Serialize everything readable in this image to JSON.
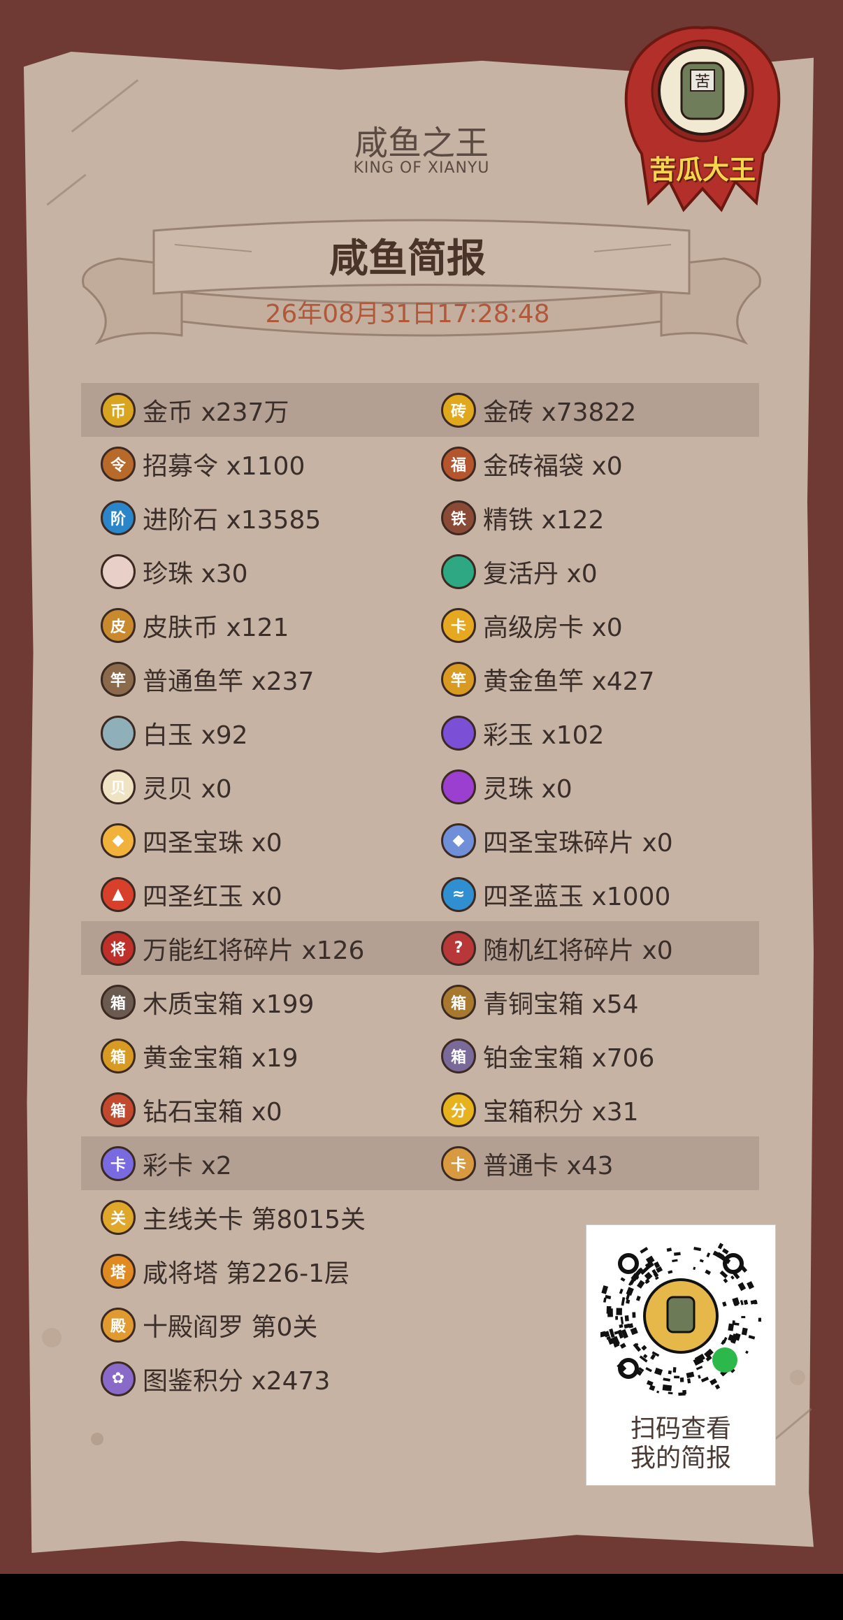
{
  "header": {
    "title": "咸鱼之王",
    "subtitle": "KING OF XIANYU",
    "banner_title": "咸鱼简报",
    "date": "26年08月31日17:28:48"
  },
  "player": {
    "name": "苦瓜大王",
    "avatar_glyph": "苦"
  },
  "colors": {
    "frame": "#6e3a33",
    "paper": "#c7b3a3",
    "highlight_row": "#b3a092",
    "date_text": "#b0593a",
    "seal_red": "#c0392b",
    "seal_text": "#f6d64a"
  },
  "items": [
    {
      "highlight": true,
      "left": {
        "label": "金币 x237万",
        "icon": "coin-icon",
        "color": "#d9a520",
        "glyph": "币"
      },
      "right": {
        "label": "金砖 x73822",
        "icon": "gold-brick-icon",
        "color": "#e0a81c",
        "glyph": "砖"
      }
    },
    {
      "highlight": false,
      "left": {
        "label": "招募令 x1100",
        "icon": "recruit-order-icon",
        "color": "#b86a2a",
        "glyph": "令"
      },
      "right": {
        "label": "金砖福袋 x0",
        "icon": "lucky-bag-icon",
        "color": "#b5552e",
        "glyph": "福"
      }
    },
    {
      "highlight": false,
      "left": {
        "label": "进阶石 x13585",
        "icon": "upgrade-stone-icon",
        "color": "#2a86c8",
        "glyph": "阶"
      },
      "right": {
        "label": "精铁 x122",
        "icon": "iron-icon",
        "color": "#8a4a36",
        "glyph": "铁"
      }
    },
    {
      "highlight": false,
      "left": {
        "label": "珍珠 x30",
        "icon": "pearl-icon",
        "color": "#e8cfc8",
        "glyph": ""
      },
      "right": {
        "label": "复活丹 x0",
        "icon": "revive-pill-icon",
        "color": "#2ea882",
        "glyph": ""
      }
    },
    {
      "highlight": false,
      "left": {
        "label": "皮肤币 x121",
        "icon": "skin-coin-icon",
        "color": "#c98a2e",
        "glyph": "皮"
      },
      "right": {
        "label": "高级房卡 x0",
        "icon": "room-card-icon",
        "color": "#e6a820",
        "glyph": "卡"
      }
    },
    {
      "highlight": false,
      "left": {
        "label": "普通鱼竿 x237",
        "icon": "fishing-rod-icon",
        "color": "#8a6a4a",
        "glyph": "竿"
      },
      "right": {
        "label": "黄金鱼竿 x427",
        "icon": "golden-rod-icon",
        "color": "#d99a22",
        "glyph": "竿"
      }
    },
    {
      "highlight": false,
      "left": {
        "label": "白玉 x92",
        "icon": "white-jade-icon",
        "color": "#8fb0b8",
        "glyph": ""
      },
      "right": {
        "label": "彩玉 x102",
        "icon": "color-jade-icon",
        "color": "#7b4fd6",
        "glyph": ""
      }
    },
    {
      "highlight": false,
      "left": {
        "label": "灵贝 x0",
        "icon": "shell-icon",
        "color": "#efe3c4",
        "glyph": "贝"
      },
      "right": {
        "label": "灵珠 x0",
        "icon": "spirit-orb-icon",
        "color": "#9b3fd0",
        "glyph": ""
      }
    },
    {
      "highlight": false,
      "left": {
        "label": "四圣宝珠 x0",
        "icon": "holy-orb-icon",
        "color": "#f0b23a",
        "glyph": "◆"
      },
      "right": {
        "label": "四圣宝珠碎片 x0",
        "icon": "orb-shard-icon",
        "color": "#6f8fd8",
        "glyph": "◆"
      }
    },
    {
      "highlight": false,
      "left": {
        "label": "四圣红玉 x0",
        "icon": "red-jade-icon",
        "color": "#d8402c",
        "glyph": "▲"
      },
      "right": {
        "label": "四圣蓝玉 x1000",
        "icon": "blue-jade-icon",
        "color": "#2f8fd0",
        "glyph": "≈"
      }
    },
    {
      "highlight": true,
      "left": {
        "label": "万能红将碎片 x126",
        "icon": "red-general-shard-icon",
        "color": "#c0302a",
        "glyph": "将"
      },
      "right": {
        "label": "随机红将碎片 x0",
        "icon": "random-shard-icon",
        "color": "#b8383a",
        "glyph": "?"
      }
    },
    {
      "highlight": false,
      "left": {
        "label": "木质宝箱 x199",
        "icon": "wood-chest-icon",
        "color": "#6a5a50",
        "glyph": "箱"
      },
      "right": {
        "label": "青铜宝箱 x54",
        "icon": "bronze-chest-icon",
        "color": "#a8782e",
        "glyph": "箱"
      }
    },
    {
      "highlight": false,
      "left": {
        "label": "黄金宝箱 x19",
        "icon": "gold-chest-icon",
        "color": "#d89a22",
        "glyph": "箱"
      },
      "right": {
        "label": "铂金宝箱 x706",
        "icon": "platinum-chest-icon",
        "color": "#7a6a9a",
        "glyph": "箱"
      }
    },
    {
      "highlight": false,
      "left": {
        "label": "钻石宝箱 x0",
        "icon": "diamond-chest-icon",
        "color": "#c2482e",
        "glyph": "箱"
      },
      "right": {
        "label": "宝箱积分 x31",
        "icon": "chest-points-icon",
        "color": "#e6b21e",
        "glyph": "分"
      }
    },
    {
      "highlight": true,
      "left": {
        "label": "彩卡 x2",
        "icon": "color-card-icon",
        "color": "#7a6ae0",
        "glyph": "卡"
      },
      "right": {
        "label": "普通卡 x43",
        "icon": "normal-card-icon",
        "color": "#d89a40",
        "glyph": "卡"
      }
    },
    {
      "highlight": false,
      "left": {
        "label": "主线关卡 第8015关",
        "icon": "main-stage-icon",
        "color": "#e0a82a",
        "glyph": "关"
      },
      "right": null
    },
    {
      "highlight": false,
      "left": {
        "label": "咸将塔 第226-1层",
        "icon": "tower-icon",
        "color": "#e08a22",
        "glyph": "塔"
      },
      "right": null
    },
    {
      "highlight": false,
      "left": {
        "label": "十殿阎罗 第0关",
        "icon": "yama-icon",
        "color": "#e09a30",
        "glyph": "殿"
      },
      "right": null
    },
    {
      "highlight": false,
      "left": {
        "label": "图鉴积分 x2473",
        "icon": "codex-points-icon",
        "color": "#8a6ac8",
        "glyph": "✿"
      },
      "right": null
    }
  ],
  "qr": {
    "line1": "扫码查看",
    "line2": "我的简报"
  }
}
